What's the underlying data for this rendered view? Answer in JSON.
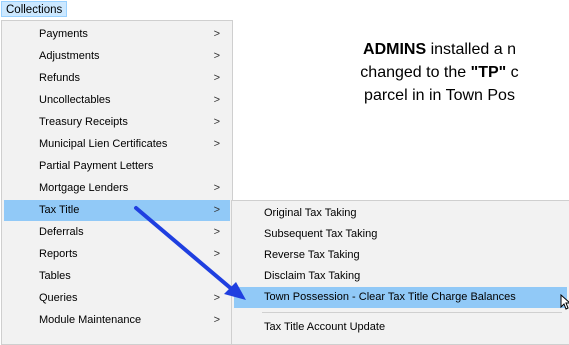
{
  "menubar": {
    "collections": "Collections"
  },
  "main_menu": {
    "items": [
      {
        "label": "Payments",
        "submenu": true
      },
      {
        "label": "Adjustments",
        "submenu": true
      },
      {
        "label": "Refunds",
        "submenu": true
      },
      {
        "label": "Uncollectables",
        "submenu": true
      },
      {
        "label": "Treasury Receipts",
        "submenu": true
      },
      {
        "label": "Municipal Lien Certificates",
        "submenu": true
      },
      {
        "label": "Partial Payment Letters",
        "submenu": false
      },
      {
        "label": "Mortgage Lenders",
        "submenu": true
      },
      {
        "label": "Tax Title",
        "submenu": true,
        "active": true
      },
      {
        "label": "Deferrals",
        "submenu": true
      },
      {
        "label": "Reports",
        "submenu": true
      },
      {
        "label": "Tables",
        "submenu": false
      },
      {
        "label": "Queries",
        "submenu": true
      },
      {
        "label": "Module Maintenance",
        "submenu": true
      }
    ],
    "arrow_glyph": ">"
  },
  "submenu": {
    "items": [
      {
        "label": "Original Tax Taking"
      },
      {
        "label": "Subsequent Tax Taking"
      },
      {
        "label": "Reverse Tax Taking"
      },
      {
        "label": "Disclaim Tax Taking"
      },
      {
        "label": "Town Possession - Clear Tax Title Charge Balances",
        "active": true
      },
      {
        "label": "Tax Title Account Update"
      }
    ]
  },
  "note": {
    "line1_bold": "ADMINS",
    "line1_rest": " installed a n",
    "line2_pre": "changed to the ",
    "line2_bold": "\"TP\"",
    "line2_rest": " c",
    "line3": "parcel in in Town Pos"
  },
  "colors": {
    "highlight": "#91c9f7",
    "menu_bg": "#f2f2f2",
    "annotation_arrow": "#1f3fe0"
  },
  "icons": {
    "cursor": "pointer-cursor-icon",
    "annotation": "annotation-arrow-icon"
  }
}
